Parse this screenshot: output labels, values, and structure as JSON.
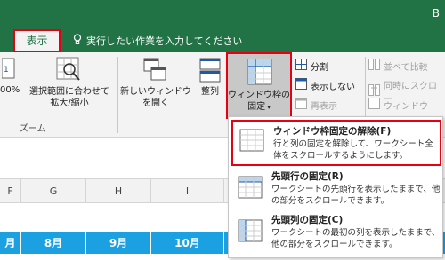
{
  "window": {
    "title_fragment": "B"
  },
  "tabs": {
    "active_label": "表示"
  },
  "tellme": {
    "text": "実行したい作業を入力してください"
  },
  "ribbon": {
    "zoom100_label": "00%",
    "zoom_selection_label_1": "選択範囲に合わせて",
    "zoom_selection_label_2": "拡大/縮小",
    "zoom_group_label": "ズーム",
    "new_window_label_1": "新しいウィンドウ",
    "new_window_label_2": "を開く",
    "arrange_label": "整列",
    "freeze_label_1": "ウィンドウ枠の",
    "freeze_label_2": "固定",
    "split_label": "分割",
    "hide_label": "表示しない",
    "unhide_label": "再表示",
    "side_by_side_label": "並べて比較",
    "sync_scroll_label": "同時にスクロー",
    "reset_position_label": "ウィンドウ"
  },
  "menu": {
    "items": [
      {
        "title": "ウィンドウ枠固定の解除(F)",
        "desc": "行と列の固定を解除して、ワークシート全体をスクロールするようにします。"
      },
      {
        "title": "先頭行の固定(R)",
        "desc": "ワークシートの先頭行を表示したままで、他の部分をスクロールできます。"
      },
      {
        "title": "先頭列の固定(C)",
        "desc": "ワークシートの最初の列を表示したままで、他の部分をスクロールできます。"
      }
    ]
  },
  "sheet": {
    "columns": [
      "F",
      "G",
      "H",
      "I"
    ],
    "months": [
      "月",
      "8月",
      "9月",
      "10月"
    ]
  }
}
